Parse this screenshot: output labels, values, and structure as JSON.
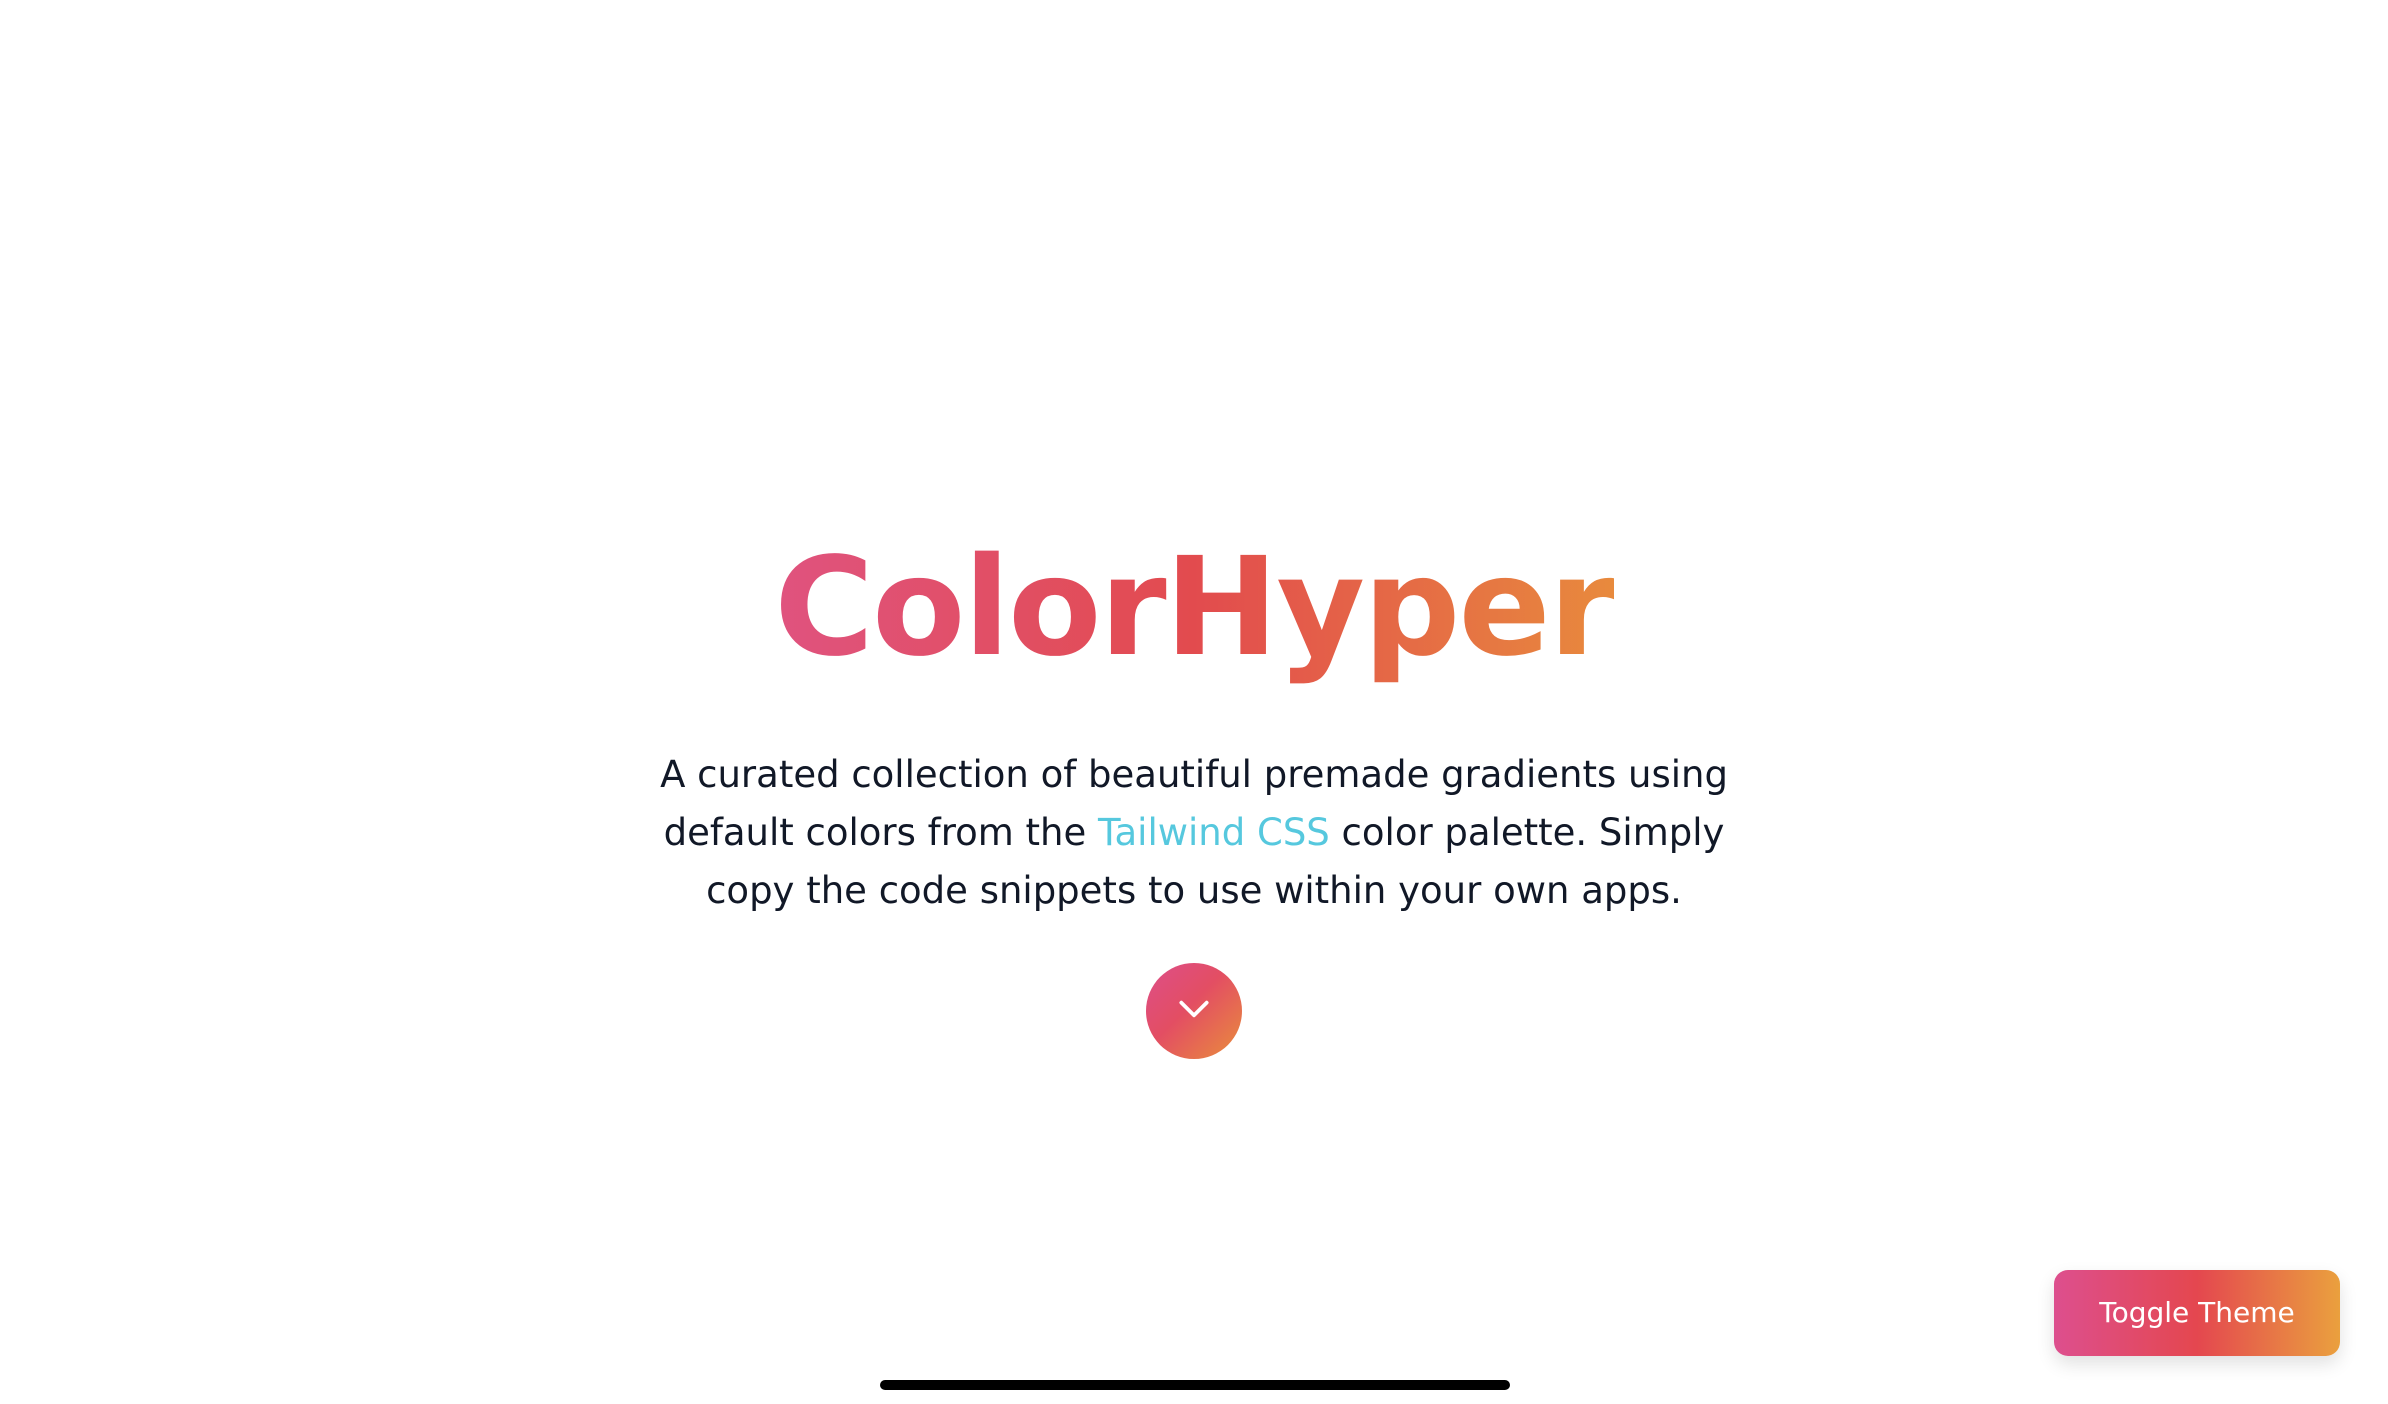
{
  "hero": {
    "title": "ColorHyper",
    "description_before": "A curated collection of beautiful premade gradients using default colors from the ",
    "description_link": "Tailwind CSS",
    "description_after": " color palette. Simply copy the code snippets to use within your own apps.",
    "scroll_icon": "chevron-down-icon"
  },
  "controls": {
    "toggle_theme_label": "Toggle Theme"
  },
  "colors": {
    "title_gradient": [
      "#e0537f",
      "#e24b4e",
      "#e88a3d"
    ],
    "link": "#56c8de",
    "button_gradient": [
      "#dd4f8e",
      "#e4474f",
      "#eaa03e"
    ],
    "text": "#111827",
    "background": "#ffffff"
  }
}
